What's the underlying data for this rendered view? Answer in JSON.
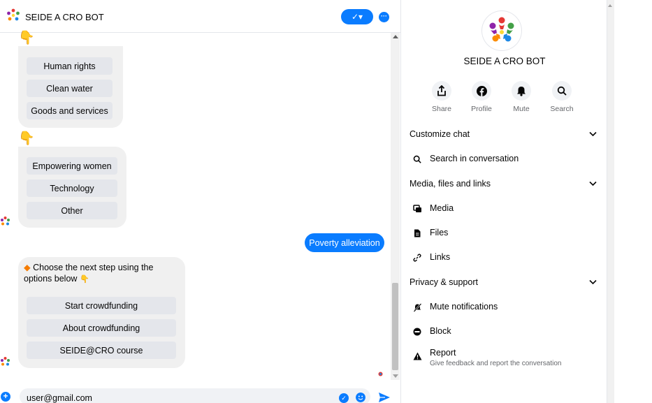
{
  "header": {
    "title": "SEIDE A CRO BOT",
    "check_label": "✓▾",
    "more_label": "···"
  },
  "messages": {
    "group1": [
      "Human rights",
      "Clean water",
      "Goods and services"
    ],
    "group2": [
      "Empowering women",
      "Technology",
      "Other"
    ],
    "sent": "Poverty alleviation",
    "prompt": "Choose the next step using the options below",
    "group3": [
      "Start crowdfunding",
      "About crowdfunding",
      "SEIDE@CRO course"
    ]
  },
  "composer": {
    "value": "user@gmail.com"
  },
  "details": {
    "name": "SEIDE A CRO BOT",
    "actions": {
      "share": "Share",
      "profile": "Profile",
      "mute": "Mute",
      "search": "Search"
    },
    "sections": {
      "customize": "Customize chat",
      "search_conv": "Search in conversation",
      "media_files": "Media, files and links",
      "media": "Media",
      "files": "Files",
      "links": "Links",
      "privacy": "Privacy & support",
      "mute_notif": "Mute notifications",
      "block": "Block",
      "report": "Report",
      "report_sub": "Give feedback and report the conversation"
    }
  },
  "colors": {
    "accent": "#0a7cff",
    "bubble": "#f0f0f0",
    "option": "#e4e6eb"
  },
  "icons": [
    "share-icon",
    "facebook-icon",
    "bell-icon",
    "search-icon",
    "media-icon",
    "file-icon",
    "link-icon",
    "mute-icon",
    "block-icon",
    "report-icon",
    "send-icon"
  ]
}
